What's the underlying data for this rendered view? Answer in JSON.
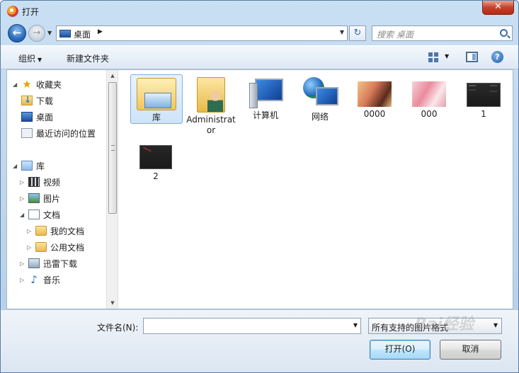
{
  "window": {
    "title": "打开",
    "close_label": "✕"
  },
  "nav": {
    "address_location": "桌面",
    "search_placeholder": "搜索 桌面"
  },
  "toolbar": {
    "organize_label": "组织",
    "new_folder_label": "新建文件夹",
    "help_label": "?"
  },
  "sidebar": {
    "items": [
      {
        "label": "收藏夹",
        "icon": "star-icon"
      },
      {
        "label": "下载",
        "icon": "downloads-folder-icon"
      },
      {
        "label": "桌面",
        "icon": "desktop-icon"
      },
      {
        "label": "最近访问的位置",
        "icon": "recent-places-icon"
      },
      {
        "label": "库",
        "icon": "libraries-icon"
      },
      {
        "label": "视频",
        "icon": "videos-icon"
      },
      {
        "label": "图片",
        "icon": "pictures-icon"
      },
      {
        "label": "文档",
        "icon": "documents-icon"
      },
      {
        "label": "我的文档",
        "icon": "folder-icon"
      },
      {
        "label": "公用文档",
        "icon": "folder-icon"
      },
      {
        "label": "迅雷下载",
        "icon": "thunder-download-icon"
      },
      {
        "label": "音乐",
        "icon": "music-icon"
      }
    ]
  },
  "files": [
    {
      "label": "库",
      "icon": "libraries-icon"
    },
    {
      "label": "Administrator",
      "icon": "user-folder-icon"
    },
    {
      "label": "计算机",
      "icon": "computer-icon"
    },
    {
      "label": "网络",
      "icon": "network-icon"
    },
    {
      "label": "0000",
      "icon": "image-thumbnail"
    },
    {
      "label": "000",
      "icon": "image-thumbnail"
    },
    {
      "label": "1",
      "icon": "image-thumbnail"
    },
    {
      "label": "2",
      "icon": "image-thumbnail"
    }
  ],
  "footer": {
    "filename_label": "文件名(N):",
    "filename_value": "",
    "filter_value": "所有支持的图片格式",
    "open_label": "打开(O)",
    "cancel_label": "取消",
    "watermark": "Bai经验"
  }
}
